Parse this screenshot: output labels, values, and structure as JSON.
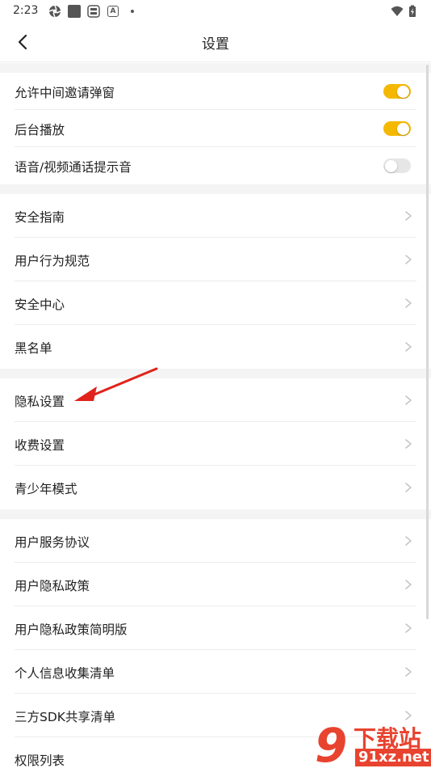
{
  "status_bar": {
    "time": "2:23"
  },
  "header": {
    "title": "设置"
  },
  "groups": [
    {
      "rows": [
        {
          "label": "允许中间邀请弹窗",
          "type": "toggle",
          "on": true
        },
        {
          "label": "后台播放",
          "type": "toggle",
          "on": true
        },
        {
          "label": "语音/视频通话提示音",
          "type": "toggle",
          "on": false
        }
      ]
    },
    {
      "rows": [
        {
          "label": "安全指南",
          "type": "link"
        },
        {
          "label": "用户行为规范",
          "type": "link"
        },
        {
          "label": "安全中心",
          "type": "link"
        },
        {
          "label": "黑名单",
          "type": "link"
        }
      ]
    },
    {
      "rows": [
        {
          "label": "隐私设置",
          "type": "link"
        },
        {
          "label": "收费设置",
          "type": "link"
        },
        {
          "label": "青少年模式",
          "type": "link"
        }
      ]
    },
    {
      "rows": [
        {
          "label": "用户服务协议",
          "type": "link"
        },
        {
          "label": "用户隐私政策",
          "type": "link"
        },
        {
          "label": "用户隐私政策简明版",
          "type": "link"
        },
        {
          "label": "个人信息收集清单",
          "type": "link"
        },
        {
          "label": "三方SDK共享清单",
          "type": "link"
        },
        {
          "label": "权限列表",
          "type": "link"
        }
      ]
    }
  ],
  "colors": {
    "accent": "#f5b800",
    "toggle_off": "#e6e6e6",
    "annotation_arrow": "#e0231b"
  },
  "icons": [
    "back-icon",
    "chevron-right-icon"
  ],
  "watermark": {
    "digit": "9",
    "brand": "下载站",
    "url": "91xz.net"
  }
}
